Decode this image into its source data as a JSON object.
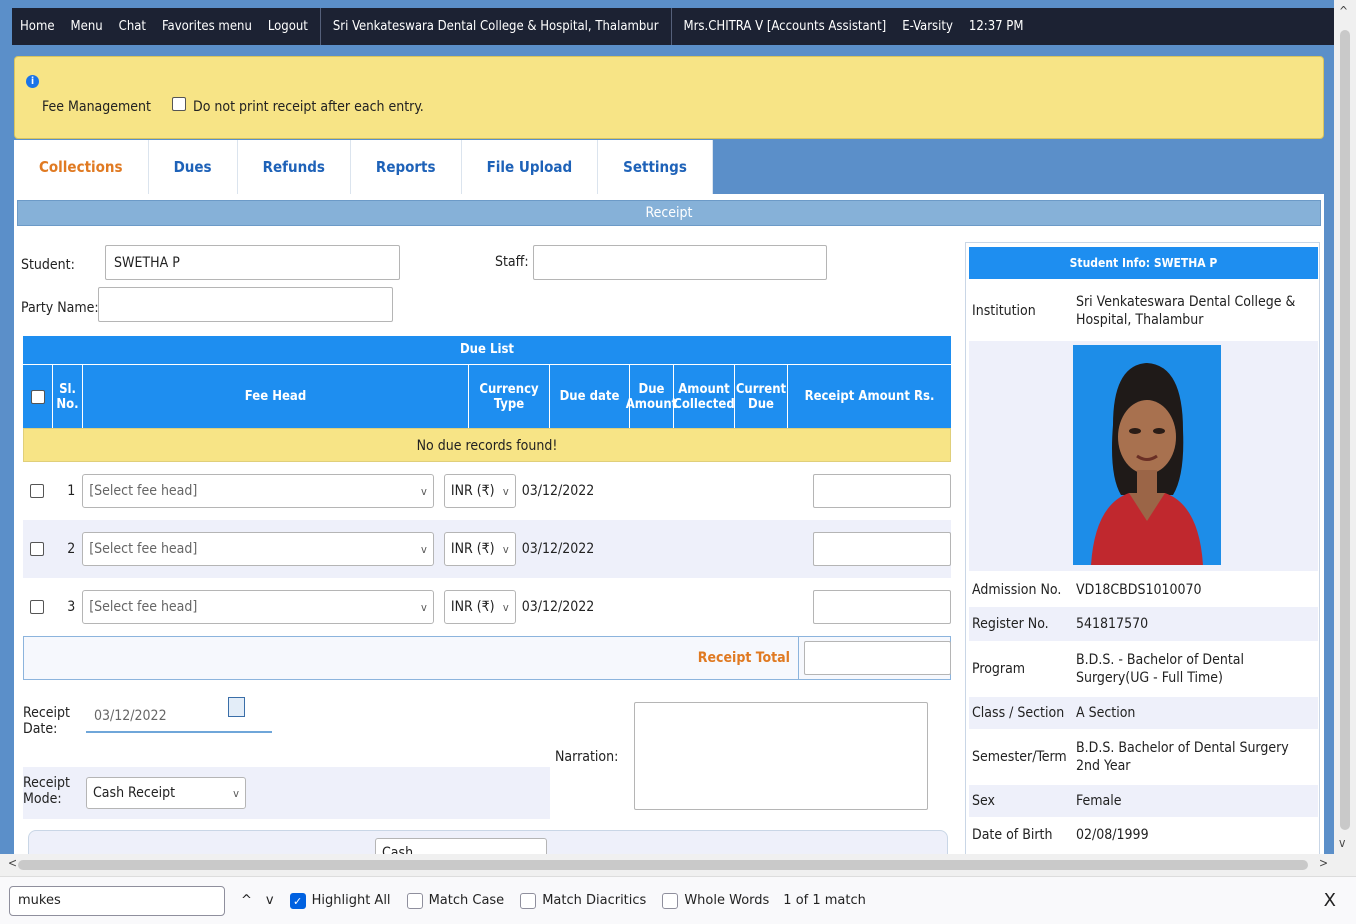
{
  "topbar": {
    "items": [
      "Home",
      "Menu",
      "Chat",
      "Favorites menu",
      "Logout"
    ],
    "institution": "Sri Venkateswara Dental College & Hospital, Thalambur",
    "user": "Mrs.CHITRA V [Accounts Assistant]",
    "evarsity": "E-Varsity",
    "time": "12:37 PM"
  },
  "notice": {
    "title": "Fee Management",
    "checkbox_label": "Do not print receipt after each entry."
  },
  "tabs": [
    "Collections",
    "Dues",
    "Refunds",
    "Reports",
    "File Upload",
    "Settings"
  ],
  "receipt": {
    "title": "Receipt",
    "student_label": "Student:",
    "student_value": "SWETHA P",
    "staff_label": "Staff:",
    "party_label": "Party Name:"
  },
  "due_list": {
    "title": "Due List",
    "columns": [
      "Sl. No.",
      "Fee Head",
      "Currency Type",
      "Due date",
      "Due Amount",
      "Amount Collected",
      "Current Due",
      "Receipt Amount Rs."
    ],
    "empty_message": "No due records found!",
    "rows": [
      {
        "no": "1",
        "fee_head": "[Select fee head]",
        "currency": "INR (₹)",
        "date": "03/12/2022"
      },
      {
        "no": "2",
        "fee_head": "[Select fee head]",
        "currency": "INR (₹)",
        "date": "03/12/2022"
      },
      {
        "no": "3",
        "fee_head": "[Select fee head]",
        "currency": "INR (₹)",
        "date": "03/12/2022"
      }
    ],
    "total_label": "Receipt Total"
  },
  "form": {
    "receipt_date_label": "Receipt Date:",
    "receipt_date_value": "03/12/2022",
    "receipt_mode_label": "Receipt Mode:",
    "receipt_mode_value": "Cash Receipt",
    "narration_label": "Narration:",
    "partial_select_value": "Cash"
  },
  "student_info": {
    "title_prefix": "Student Info: ",
    "title_name": "SWETHA P",
    "institution_label": "Institution",
    "institution": "Sri Venkateswara Dental College & Hospital, Thalambur",
    "fields": [
      {
        "k": "Admission No.",
        "v": "VD18CBDS1010070"
      },
      {
        "k": "Register No.",
        "v": "541817570"
      },
      {
        "k": "Program",
        "v": "B.D.S. - Bachelor of Dental Surgery(UG - Full Time)"
      },
      {
        "k": "Class / Section",
        "v": "A Section"
      },
      {
        "k": "Semester/Term",
        "v": "B.D.S. Bachelor of Dental Surgery 2nd Year"
      },
      {
        "k": "Sex",
        "v": "Female"
      },
      {
        "k": "Date of Birth",
        "v": "02/08/1999"
      }
    ]
  },
  "findbar": {
    "query": "mukes",
    "highlight_all": "Highlight All",
    "match_case": "Match Case",
    "match_diacritics": "Match Diacritics",
    "whole_words": "Whole Words",
    "result": "1 of 1 match"
  }
}
